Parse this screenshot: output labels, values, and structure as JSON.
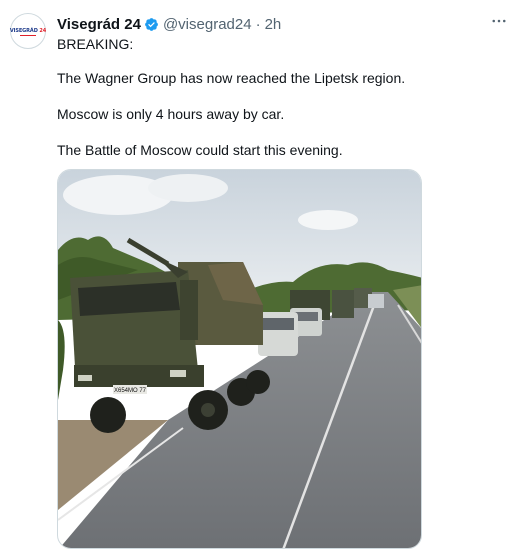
{
  "tweet": {
    "author": {
      "display_name": "Visegrád 24",
      "handle": "@visegrad24",
      "avatar_text": "VISEGRÁD",
      "avatar_number": "24",
      "verified": true
    },
    "separator": "·",
    "timestamp": "2h",
    "more_icon": "more-horizontal-icon",
    "text_lines": [
      "BREAKING:",
      "The Wagner Group has now reached the Lipetsk region.",
      "Moscow is only 4 hours away by car.",
      "The Battle of Moscow could start this evening."
    ],
    "image": {
      "description_icon": "military-convoy-photo",
      "license_plate": "Х654МО 77"
    }
  },
  "colors": {
    "text": "#0f1419",
    "secondary": "#536471",
    "verified": "#1d9bf0",
    "avatar_blue": "#1d3a8a",
    "avatar_red": "#e0202a"
  }
}
